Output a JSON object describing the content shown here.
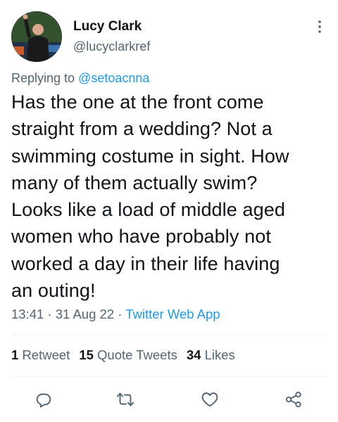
{
  "author": {
    "display_name": "Lucy Clark",
    "handle": "@lucyclarkref"
  },
  "reply": {
    "prefix": "Replying to ",
    "mention": "@setoacnna"
  },
  "tweet": {
    "lines": [
      "Has the one at the front come",
      "straight from a wedding? Not a",
      "swimming costume in sight. How",
      "many of them actually swim?",
      "Looks like a load of middle aged",
      "women who have probably not",
      "worked a day in their life having",
      "an outing!"
    ]
  },
  "meta": {
    "time": "13:41",
    "separator": " · ",
    "date": "31 Aug 22",
    "source": "Twitter Web App"
  },
  "stats": {
    "retweets_count": "1",
    "retweets_label": "Retweet",
    "quotes_count": "15",
    "quotes_label": "Quote Tweets",
    "likes_count": "34",
    "likes_label": "Likes"
  },
  "icons": {
    "more": "more-icon",
    "reply": "reply-icon",
    "retweet": "retweet-icon",
    "like": "heart-icon",
    "share": "share-icon"
  },
  "colors": {
    "accent": "#1d9bf0",
    "text": "#0f1419",
    "muted": "#536471",
    "divider": "#eff3f4"
  }
}
